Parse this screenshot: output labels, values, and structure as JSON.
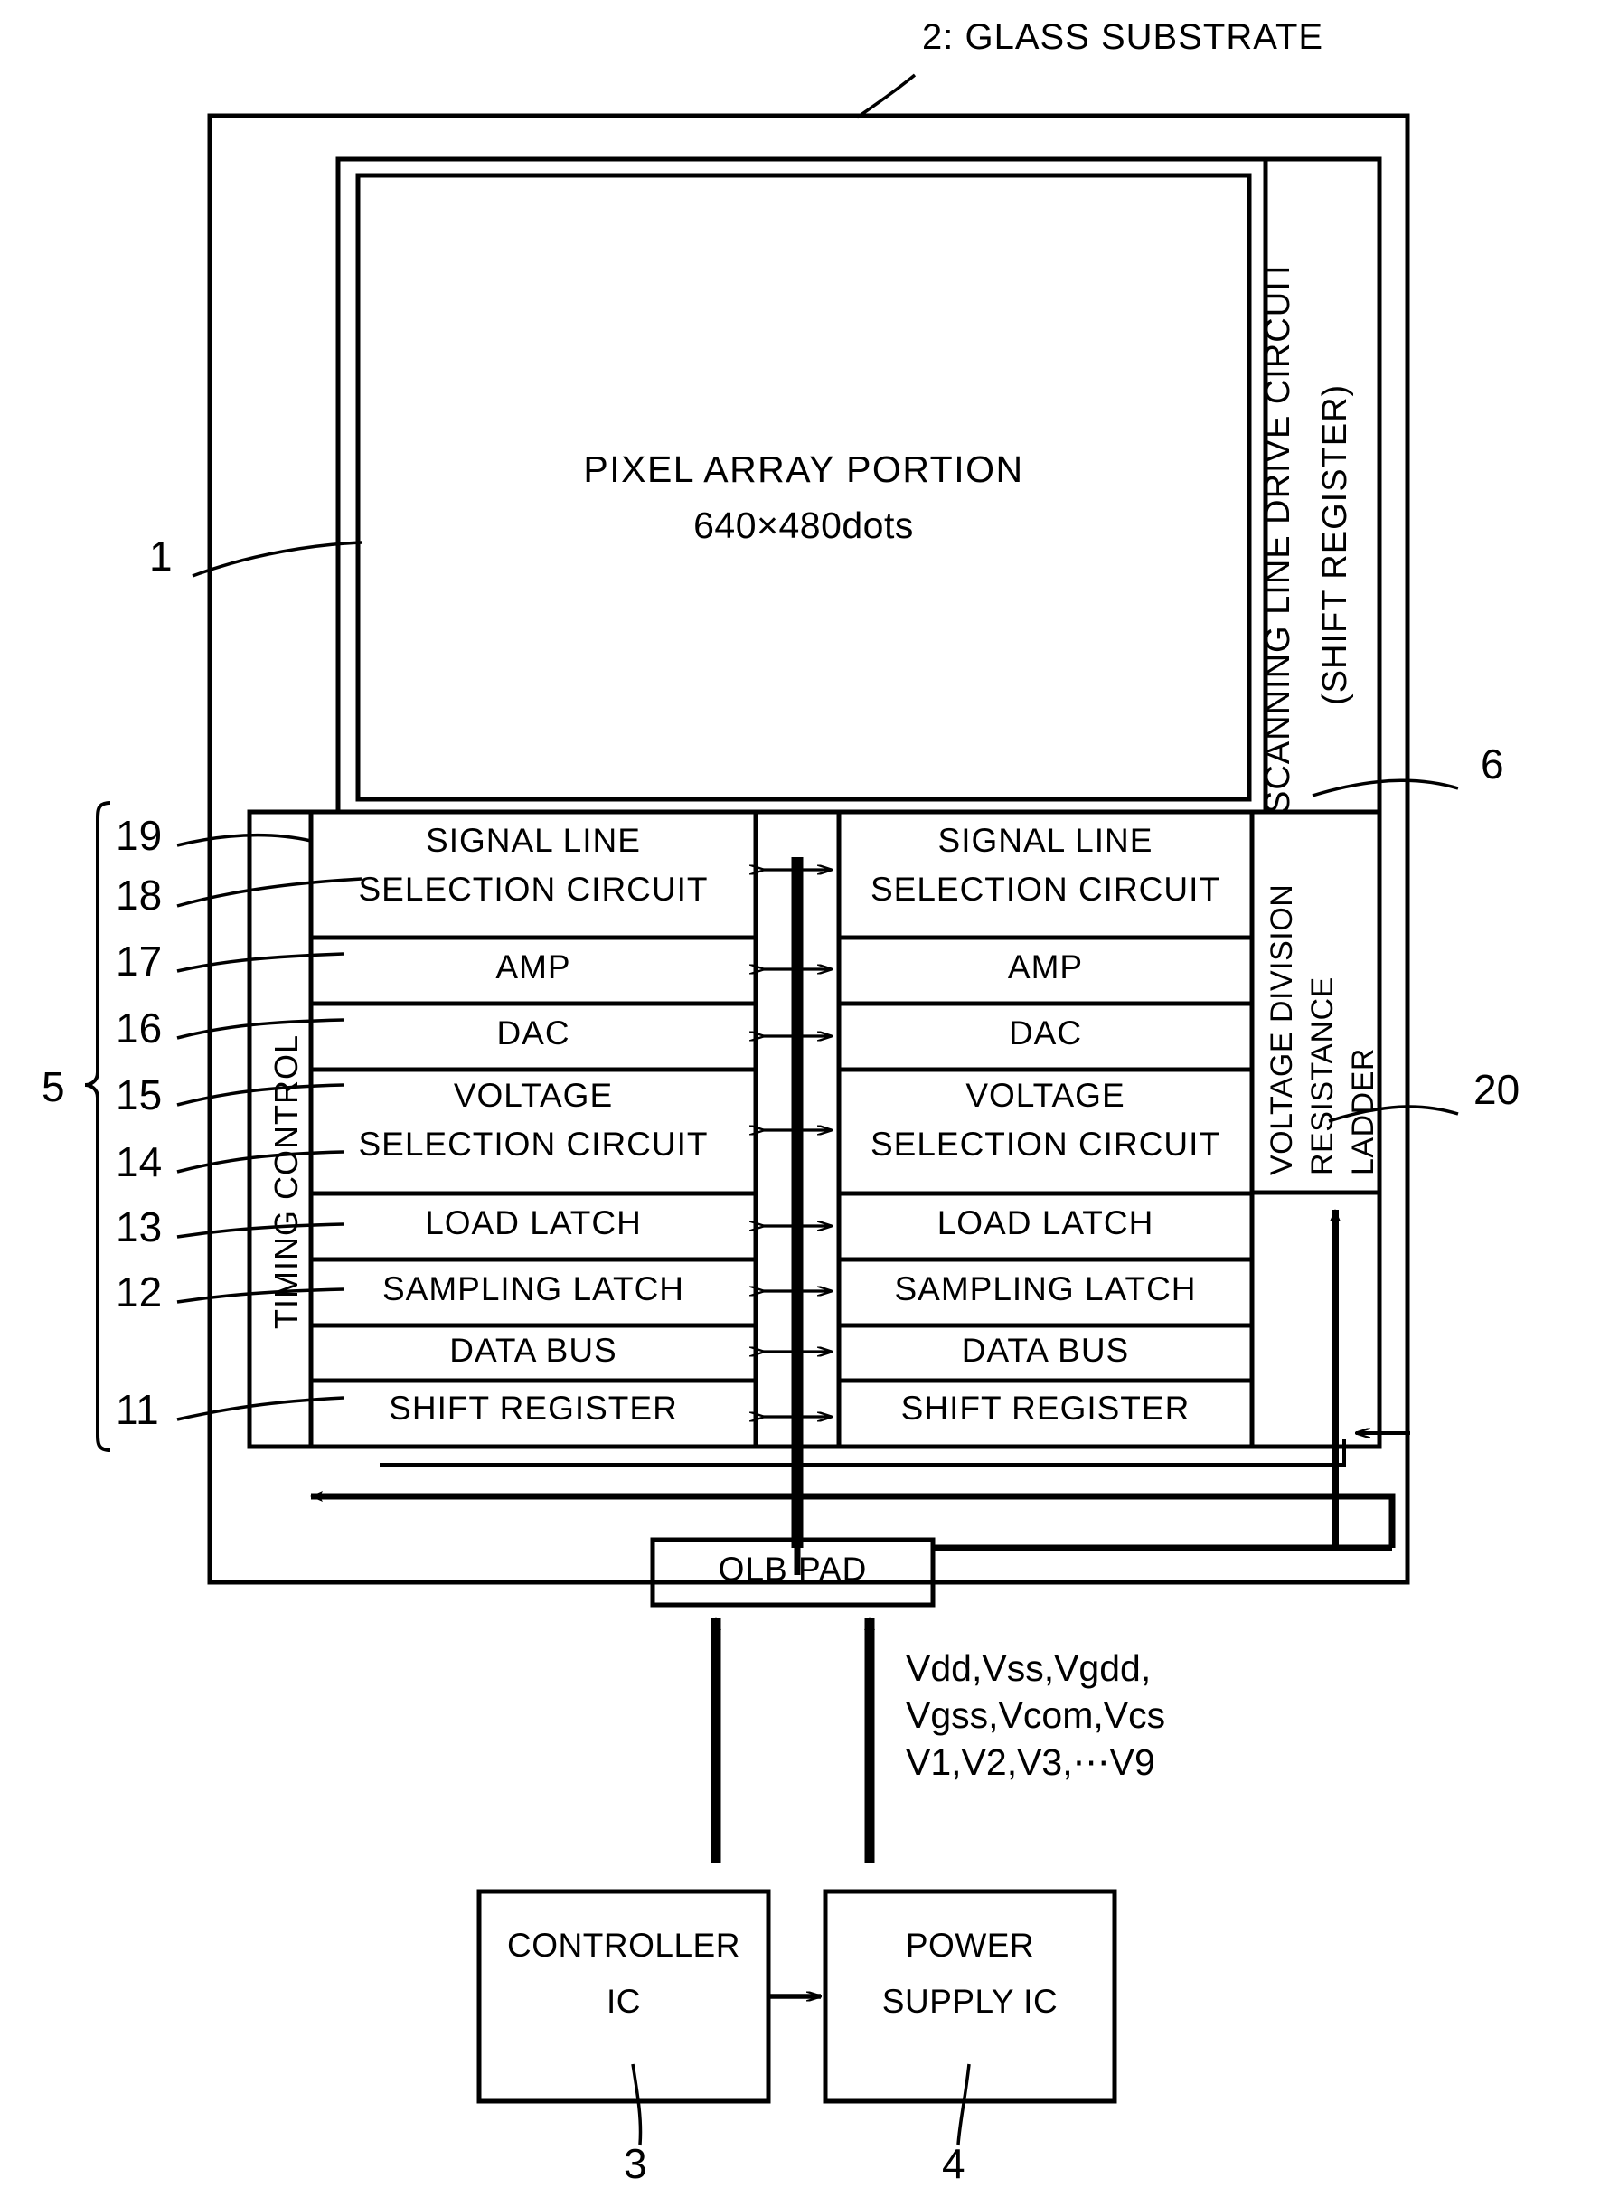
{
  "figure": {
    "callout_glass_substrate": "2: GLASS SUBSTRATE",
    "ref_pixel_array": "1",
    "ref_scanning_drive": "6",
    "ref_voltage_ladder": "20",
    "ref_driver_group": "5",
    "ref_controller_ic": "3",
    "ref_power_supply_ic": "4"
  },
  "pixel_array": {
    "title": "PIXEL ARRAY PORTION",
    "resolution": "640×480dots"
  },
  "scanning_line_drive": {
    "line1": "SCANNING LINE DRIVE CIRCUIT",
    "line2": "(SHIFT REGISTER)"
  },
  "timing_control": {
    "label": "TIMING CONTROL"
  },
  "voltage_ladder": {
    "line1": "VOLTAGE DIVISION",
    "line2": "RESISTANCE",
    "line3": "LADDER"
  },
  "driver_rows": [
    {
      "ref": "19",
      "label_line1": "SIGNAL LINE",
      "label_line2": "SELECTION CIRCUIT"
    },
    {
      "ref": "17",
      "label_line1": "AMP",
      "label_line2": ""
    },
    {
      "ref": "16",
      "label_line1": "DAC",
      "label_line2": ""
    },
    {
      "ref": "15",
      "label_line1": "VOLTAGE",
      "label_line2": "SELECTION CIRCUIT"
    },
    {
      "ref": "14",
      "label_line1": "LOAD LATCH",
      "label_line2": ""
    },
    {
      "ref": "13",
      "label_line1": "SAMPLING LATCH",
      "label_line2": ""
    },
    {
      "ref": "12",
      "label_line1": "DATA BUS",
      "label_line2": ""
    },
    {
      "ref": "11",
      "label_line1": "SHIFT REGISTER",
      "label_line2": ""
    }
  ],
  "extra_ref": {
    "ref18": "18"
  },
  "olb_pad": {
    "label": "OLB PAD"
  },
  "power_signals": {
    "line1": "Vdd,Vss,Vgdd,",
    "line2": "Vgss,Vcom,Vcs",
    "line3": "V1,V2,V3,⋯V9"
  },
  "controller_ic": {
    "line1": "CONTROLLER",
    "line2": "IC"
  },
  "power_supply_ic": {
    "line1": "POWER",
    "line2": "SUPPLY IC"
  },
  "colors": {
    "ink": "#000000",
    "paper": "#ffffff"
  }
}
